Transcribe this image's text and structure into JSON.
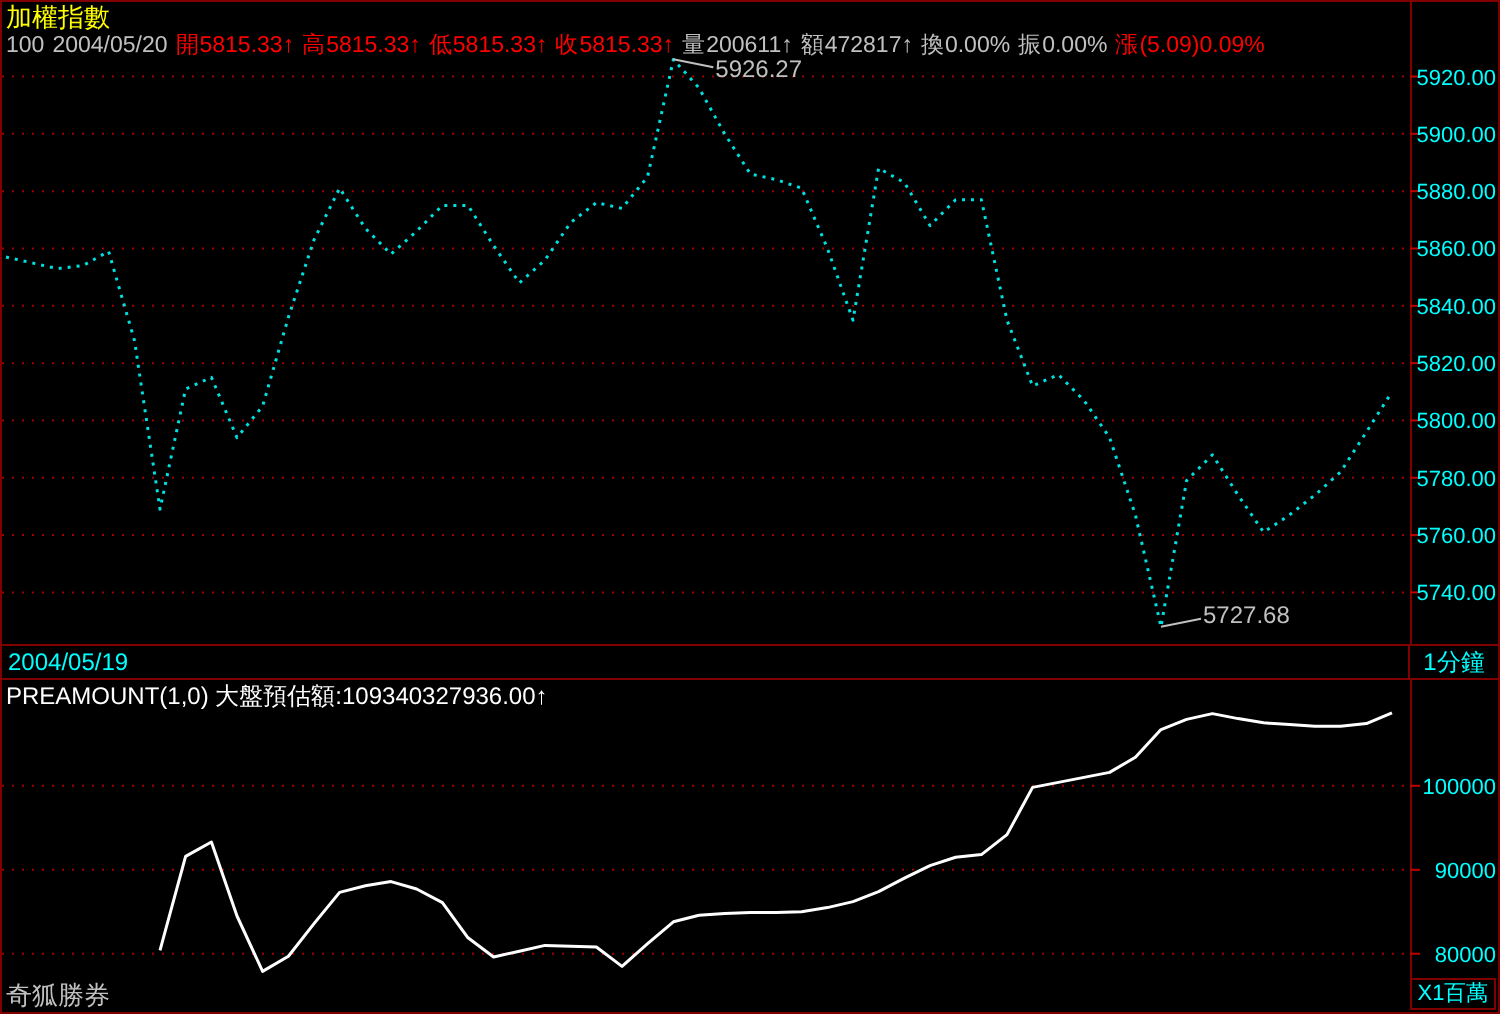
{
  "top_panel": {
    "title": "加權指數",
    "quote_items": [
      {
        "text": "100",
        "color": "#c0c0c0"
      },
      {
        "text": "2004/05/20",
        "color": "#c0c0c0"
      },
      {
        "text": "開5815.33↑",
        "color": "#ff0000"
      },
      {
        "text": "高5815.33↑",
        "color": "#ff0000"
      },
      {
        "text": "低5815.33↑",
        "color": "#ff0000"
      },
      {
        "text": "收5815.33↑",
        "color": "#ff0000"
      },
      {
        "text": "量200611↑",
        "color": "#c0c0c0"
      },
      {
        "text": "額472817↑",
        "color": "#c0c0c0"
      },
      {
        "text": "換0.00%",
        "color": "#c0c0c0"
      },
      {
        "text": "振0.00%",
        "color": "#c0c0c0"
      },
      {
        "text": "漲(5.09)0.09%",
        "color": "#ff0000"
      }
    ],
    "chart_data": {
      "type": "line",
      "categories": [
        null,
        null,
        null,
        null,
        null,
        null,
        null,
        null,
        null,
        null,
        null,
        null,
        null,
        null,
        null,
        null,
        null,
        null,
        null,
        null,
        null,
        null,
        null,
        null,
        null,
        null,
        null,
        null,
        null,
        null,
        null,
        null,
        null,
        null,
        null,
        null,
        null,
        null,
        null,
        null,
        null,
        null,
        null,
        null,
        null,
        null,
        null,
        null,
        null,
        null,
        null,
        null,
        null,
        null,
        null
      ],
      "grid": true,
      "ylim": [
        5722,
        5946
      ],
      "series": [
        {
          "color": "#00e0e0",
          "line_style": "dotted",
          "values": [
            5857,
            5855,
            5853,
            5854,
            5859,
            5828,
            5769,
            5811,
            5815,
            5794,
            5805,
            5836,
            5863,
            5881,
            5867,
            5858,
            5866,
            5875,
            5875,
            5861,
            5848,
            5856,
            5869,
            5876,
            5874,
            5885,
            5926,
            5916,
            5900,
            5886,
            5884,
            5881,
            5860,
            5835,
            5888,
            5883,
            5868,
            5877,
            5877,
            5835,
            5812,
            5816,
            5807,
            5794,
            5767,
            5728,
            5779,
            5788,
            5774,
            5761,
            5767,
            5774,
            5782,
            5796,
            5810
          ]
        }
      ],
      "yticks": [
        {
          "value": 5740,
          "label": "5740.00"
        },
        {
          "value": 5760,
          "label": "5760.00"
        },
        {
          "value": 5780,
          "label": "5780.00"
        },
        {
          "value": 5800,
          "label": "5800.00"
        },
        {
          "value": 5820,
          "label": "5820.00"
        },
        {
          "value": 5840,
          "label": "5840.00"
        },
        {
          "value": 5860,
          "label": "5860.00"
        },
        {
          "value": 5880,
          "label": "5880.00"
        },
        {
          "value": 5900,
          "label": "5900.00"
        },
        {
          "value": 5920,
          "label": "5920.00"
        }
      ],
      "annotations": [
        "5926.27",
        "5727.68"
      ]
    }
  },
  "date_bar": {
    "date": "2004/05/19",
    "interval": "1分鐘"
  },
  "bottom_panel": {
    "indicator": "PREAMOUNT(1,0) 大盤預估額:109340327936.00↑",
    "chart_data": {
      "type": "line",
      "ylabel": "X1百萬",
      "categories": [
        null,
        null,
        null,
        null,
        null,
        null,
        null,
        null,
        null,
        null,
        null,
        null,
        null,
        null,
        null,
        null,
        null,
        null,
        null,
        null,
        null,
        null,
        null,
        null,
        null,
        null,
        null,
        null,
        null,
        null,
        null,
        null,
        null,
        null,
        null,
        null,
        null,
        null,
        null,
        null,
        null,
        null,
        null,
        null,
        null,
        null,
        null,
        null,
        null,
        null,
        null,
        null,
        null,
        null,
        null
      ],
      "grid": true,
      "ylim": [
        73300,
        112600
      ],
      "series": [
        {
          "color": "#ffffff",
          "line_style": "solid",
          "values": [
            null,
            null,
            null,
            null,
            null,
            null,
            80400,
            91600,
            93300,
            84500,
            77900,
            79700,
            83600,
            87300,
            88100,
            88600,
            87700,
            86100,
            81900,
            79600,
            80300,
            81000,
            80900,
            80800,
            78500,
            81200,
            83800,
            84600,
            84800,
            84900,
            84900,
            85000,
            85500,
            86200,
            87400,
            89000,
            90500,
            91500,
            91800,
            94200,
            99800,
            100400,
            101000,
            101600,
            103400,
            106700,
            107900,
            108600,
            108000,
            107500,
            107300,
            107100,
            107100,
            107400,
            108700
          ]
        }
      ],
      "yticks": [
        80000,
        90000,
        100000
      ]
    }
  },
  "broker": "奇狐勝券"
}
